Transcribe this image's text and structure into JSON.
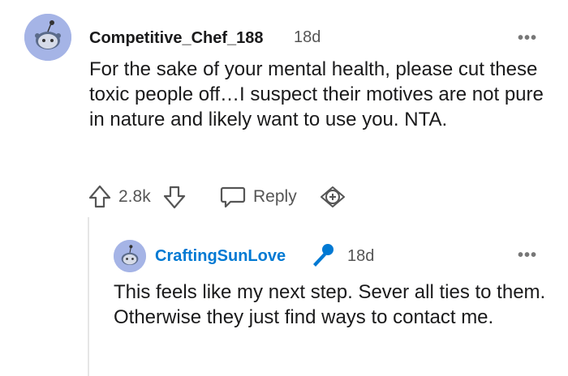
{
  "comment": {
    "username": "Competitive_Chef_188",
    "time": "18d",
    "body": "For the sake of your mental health, please cut these toxic people off…I suspect their motives are not pure in nature and likely want to use you. NTA.",
    "score": "2.8k",
    "reply_label": "Reply",
    "more_label": "•••"
  },
  "reply": {
    "username": "CraftingSunLove",
    "time": "18d",
    "body": "This feels like my next step. Sever all ties to them. Otherwise they just find ways to contact me.",
    "more_label": "•••"
  },
  "colors": {
    "avatar_bg": "#a5b4e6",
    "op_username": "#0079d3",
    "mic_icon": "#0079d3"
  }
}
